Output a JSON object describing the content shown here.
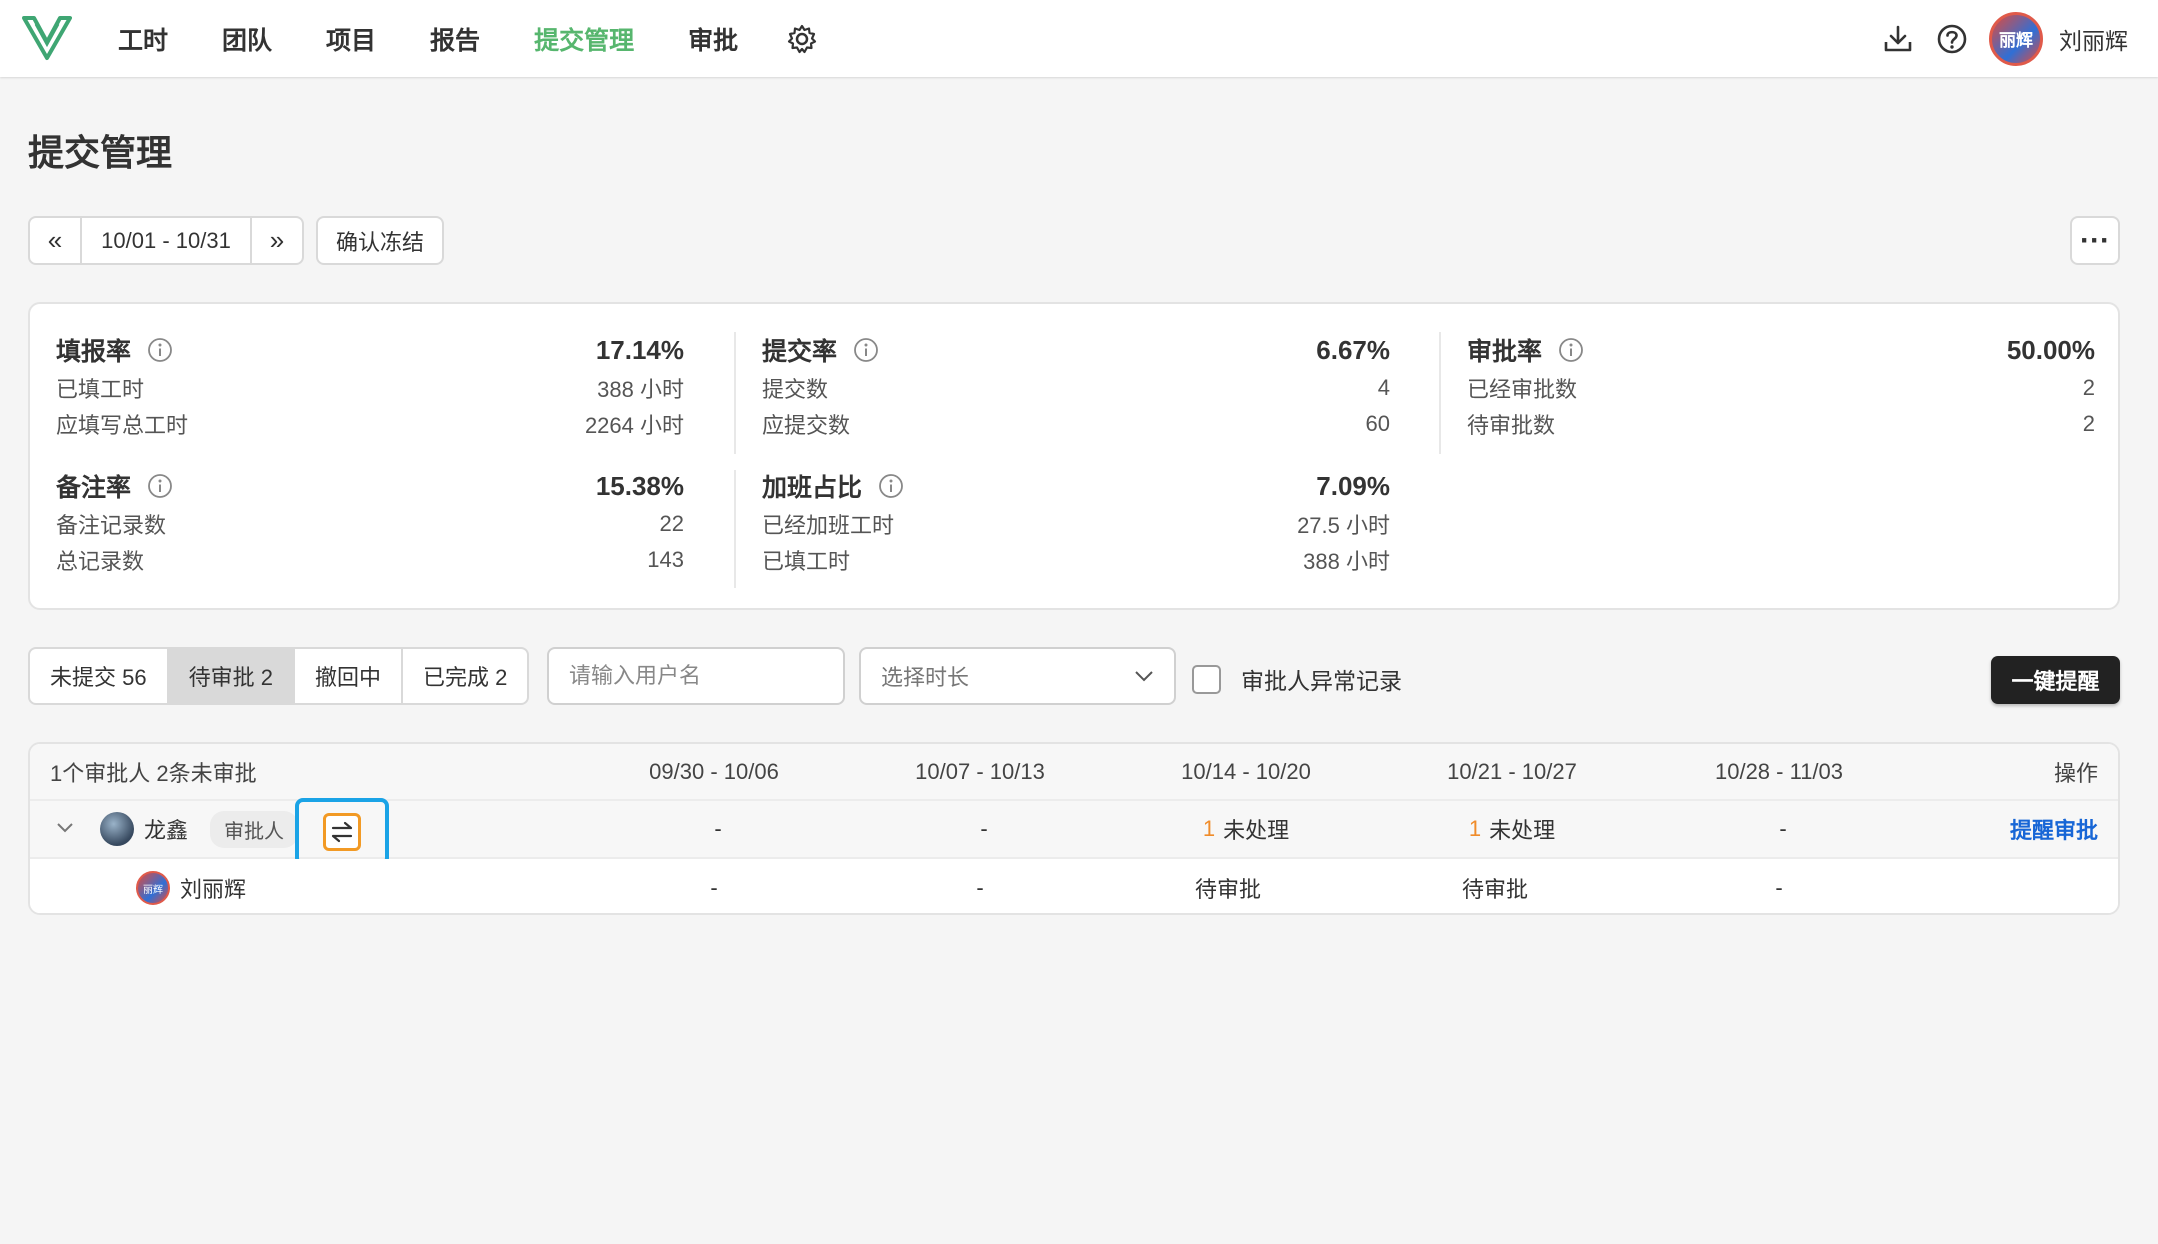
{
  "nav": {
    "items": [
      "工时",
      "团队",
      "项目",
      "报告",
      "提交管理",
      "审批"
    ],
    "active": "提交管理",
    "active_color": "#57b66e",
    "user": {
      "avatar_text": "丽辉",
      "name": "刘丽辉"
    }
  },
  "page": {
    "title": "提交管理"
  },
  "toolbar": {
    "prev_icon": "«",
    "next_icon": "»",
    "date_range": "10/01 - 10/31",
    "freeze_label": "确认冻结",
    "more_icon": "···"
  },
  "stats": {
    "fill": {
      "title": "填报率",
      "value": "17.14%",
      "rows": [
        {
          "label": "已填工时",
          "value": "388 小时"
        },
        {
          "label": "应填写总工时",
          "value": "2264 小时"
        }
      ]
    },
    "remark": {
      "title": "备注率",
      "value": "15.38%",
      "rows": [
        {
          "label": "备注记录数",
          "value": "22"
        },
        {
          "label": "总记录数",
          "value": "143"
        }
      ]
    },
    "submit": {
      "title": "提交率",
      "value": "6.67%",
      "rows": [
        {
          "label": "提交数",
          "value": "4"
        },
        {
          "label": "应提交数",
          "value": "60"
        }
      ]
    },
    "overtime": {
      "title": "加班占比",
      "value": "7.09%",
      "rows": [
        {
          "label": "已经加班工时",
          "value": "27.5 小时"
        },
        {
          "label": "已填工时",
          "value": "388 小时"
        }
      ]
    },
    "approve": {
      "title": "审批率",
      "value": "50.00%",
      "rows": [
        {
          "label": "已经审批数",
          "value": "2"
        },
        {
          "label": "待审批数",
          "value": "2"
        }
      ]
    }
  },
  "filters": {
    "tabs": [
      "未提交 56",
      "待审批 2",
      "撤回中",
      "已完成 2"
    ],
    "active_tab": "待审批 2",
    "search_placeholder": "请输入用户名",
    "duration_placeholder": "选择时长",
    "checkbox_label": "审批人异常记录",
    "remind_all_label": "一键提醒"
  },
  "table": {
    "summary": "1个审批人 2条未审批",
    "weeks": [
      "09/30 - 10/06",
      "10/07 - 10/13",
      "10/14 - 10/20",
      "10/21 - 10/27",
      "10/28 - 11/03"
    ],
    "action_header": "操作",
    "approver": {
      "name": "龙鑫",
      "role": "审批人",
      "cells": [
        {
          "count": "",
          "text": "-"
        },
        {
          "count": "",
          "text": "-"
        },
        {
          "count": "1",
          "text": "未处理"
        },
        {
          "count": "1",
          "text": "未处理"
        },
        {
          "count": "",
          "text": "-"
        }
      ],
      "action": "提醒审批"
    },
    "member": {
      "name": "刘丽辉",
      "avatar_text": "丽辉",
      "cells": [
        "-",
        "-",
        "待审批",
        "待审批",
        "-"
      ]
    }
  }
}
